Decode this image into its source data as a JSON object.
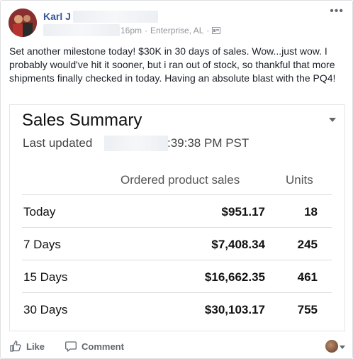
{
  "post": {
    "author": "Karl J",
    "time": "16pm",
    "location": "Enterprise, AL",
    "separator": "·",
    "more_icon": "more-horizontal-icon",
    "text": "Set another milestone today! $30K in 30 days of sales. Wow...just wow. I probably would've hit it sooner, but i ran out of stock, so thankful that more shipments finally checked in today. Having an absolute blast with the PQ4!"
  },
  "screenshot": {
    "title": "Sales Summary",
    "last_updated_label": "Last updated",
    "last_updated_time": ":39:38 PM PST",
    "columns": {
      "sales": "Ordered product sales",
      "units": "Units"
    },
    "rows": [
      {
        "label": "Today",
        "sales": "$951.17",
        "units": "18"
      },
      {
        "label": "7 Days",
        "sales": "$7,408.34",
        "units": "245"
      },
      {
        "label": "15 Days",
        "sales": "$16,662.35",
        "units": "461"
      },
      {
        "label": "30 Days",
        "sales": "$30,103.17",
        "units": "755"
      }
    ]
  },
  "actions": {
    "like": "Like",
    "comment": "Comment"
  },
  "colors": {
    "link": "#365899",
    "muted": "#90949c",
    "action": "#606770"
  }
}
